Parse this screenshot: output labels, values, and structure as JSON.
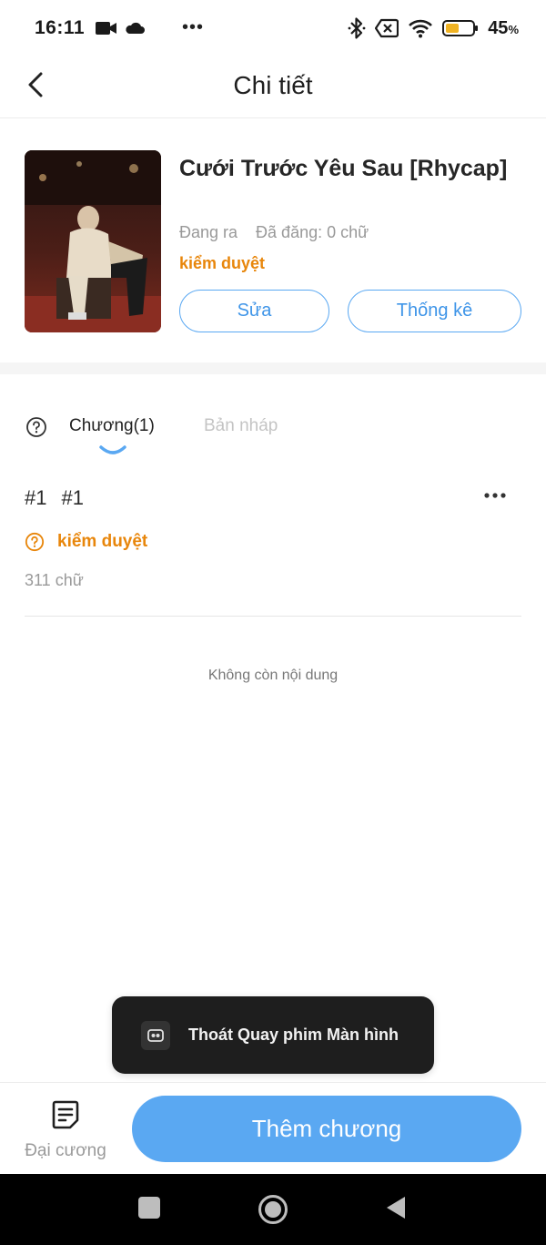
{
  "status_bar": {
    "time": "16:11",
    "dots": "•••",
    "battery_percent": "45",
    "battery_unit": "%"
  },
  "header": {
    "title": "Chi tiết"
  },
  "book": {
    "title": "Cưới Trước Yêu Sau [Rhycap]",
    "status": "Đang ra",
    "published": "Đã đăng: 0 chữ",
    "review_status": "kiểm duyệt",
    "edit_label": "Sửa",
    "stats_label": "Thống kê"
  },
  "tabs": {
    "chapters_label": "Chương(1)",
    "drafts_label": "Bản nháp"
  },
  "chapter": {
    "number": "#1",
    "name": "#1",
    "review_status": "kiểm duyệt",
    "word_count": "311 chữ"
  },
  "list_end_text": "Không còn nội dung",
  "toast": {
    "text": "Thoát Quay phim Màn hình"
  },
  "bottom_bar": {
    "outline_label": "Đại cương",
    "add_chapter_label": "Thêm chương"
  },
  "colors": {
    "accent": "#5aa8f2",
    "warning": "#e8860b"
  }
}
